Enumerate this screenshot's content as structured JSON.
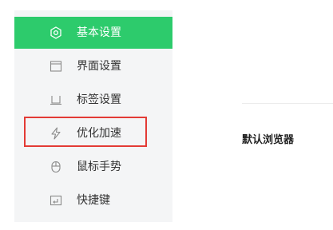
{
  "sidebar": {
    "items": [
      {
        "label": "基本设置",
        "icon": "settings-gear-icon",
        "active": true
      },
      {
        "label": "界面设置",
        "icon": "window-icon",
        "active": false
      },
      {
        "label": "标签设置",
        "icon": "tab-icon",
        "active": false
      },
      {
        "label": "优化加速",
        "icon": "lightning-icon",
        "active": false
      },
      {
        "label": "鼠标手势",
        "icon": "mouse-icon",
        "active": false
      },
      {
        "label": "快捷键",
        "icon": "keyboard-enter-icon",
        "active": false
      }
    ]
  },
  "content": {
    "default_browser_label": "默认浏览器"
  },
  "colors": {
    "active_bg": "#2dcb6c",
    "sidebar_bg": "#f4f5f6",
    "highlight_border": "#e33b35",
    "icon_gray": "#888888"
  }
}
